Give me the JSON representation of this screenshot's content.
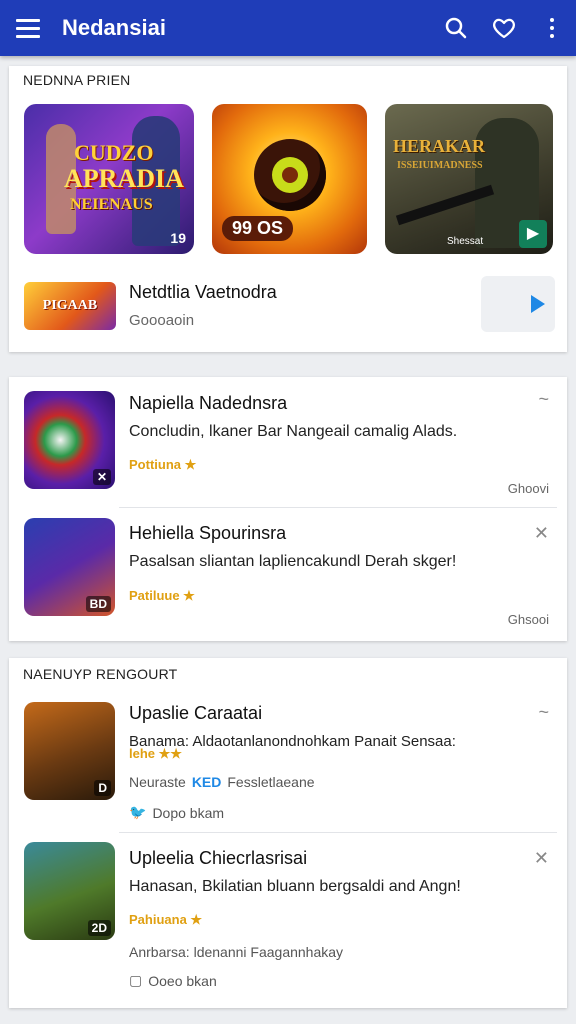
{
  "app": {
    "title": "Nedansiai"
  },
  "featured": {
    "section_label": "NEDNNA PRIEN",
    "thumbs": [
      {
        "line1": "CUDZO",
        "line2": "APRADIA",
        "line3": "NEIENAUS",
        "corner": "19"
      },
      {
        "price": "99 OS"
      },
      {
        "sign": "HERAKAR",
        "sub": "ISSEIUIMADNESS",
        "tag": "Shessat"
      }
    ],
    "row": {
      "thumb_text": "PIGAAB",
      "title": "Netdtlia Vaetnodra",
      "subtitle": "Goooaoin"
    }
  },
  "list": {
    "items": [
      {
        "title": "Napiella Nadednsra",
        "desc": "Concludin, lkaner Bar Nangeail camalig Alads.",
        "rating": "Pottiuna ★",
        "meta": "Ghoovi",
        "action": "~",
        "corner": "✕"
      },
      {
        "title": "Hehiella Spourinsra",
        "desc": "Pasalsan sliantan lapliencakundl Derah skger!",
        "rating": "Patiluue ★",
        "meta": "Ghsooi",
        "action": "✕",
        "corner": "BD"
      }
    ]
  },
  "recommend": {
    "section_label": "NAENUYP RENGOURT",
    "items": [
      {
        "title": "Upaslie Caraatai",
        "desc": "Banama: Aldaotanlanondnohkam Panait Sensaa:",
        "desc2": "lehe ★★",
        "badges": "Neuraste",
        "ked": "KED",
        "ked_text": "Fessletlaeane",
        "footer": "Dopo bkam",
        "action": "~",
        "corner": "D"
      },
      {
        "title": "Upleelia Chiecrlasrisai",
        "desc": "Hanasan, Bkilatian bluann bergsaldi and Angn!",
        "rating": "Pahiuana ★",
        "footer2": "Anrbarsa: ldenanni Faagannhakay",
        "footer": "Ooeo bkan",
        "action": "✕",
        "corner": "2D"
      }
    ]
  }
}
